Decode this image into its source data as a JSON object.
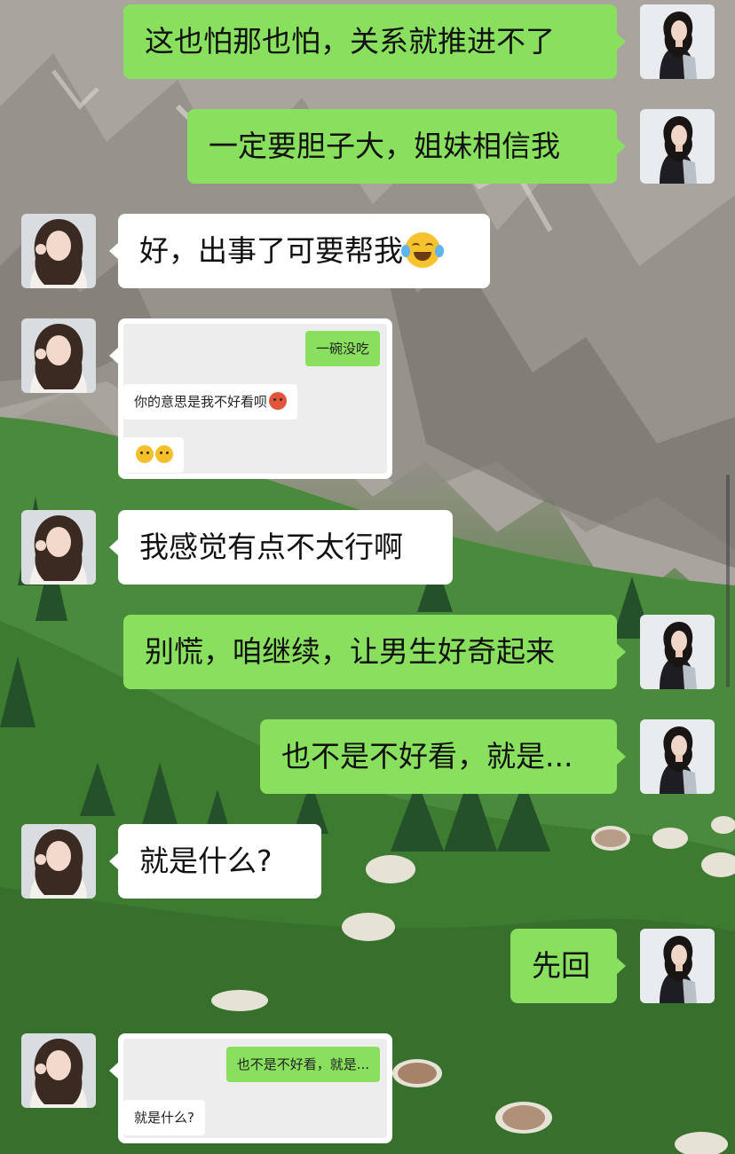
{
  "colors": {
    "bubble_self": "#89e05e",
    "bubble_other": "#ffffff",
    "quote_card_bg": "#ededed"
  },
  "messages": [
    {
      "side": "right",
      "text": "这也怕那也怕，关系就推进不了"
    },
    {
      "side": "right",
      "text": "一定要胆子大，姐妹相信我"
    },
    {
      "side": "left",
      "text": "好，出事了可要帮我",
      "emoji": "tears-of-joy-emoji"
    },
    {
      "side": "left",
      "type": "screenshot",
      "items": [
        {
          "side": "right",
          "text": "一碗没吃"
        },
        {
          "side": "left",
          "text": "你的意思是我不好看呗",
          "emoji": "angry-face-emoji"
        },
        {
          "side": "left",
          "text": "",
          "emoji": "frowning-faces-emoji"
        }
      ]
    },
    {
      "side": "left",
      "text": "我感觉有点不太行啊"
    },
    {
      "side": "right",
      "text": "别慌，咱继续，让男生好奇起来"
    },
    {
      "side": "right",
      "text": "也不是不好看，就是..."
    },
    {
      "side": "left",
      "text": "就是什么?"
    },
    {
      "side": "right",
      "text": "先回"
    },
    {
      "side": "left",
      "type": "screenshot",
      "items": [
        {
          "side": "right",
          "text": "也不是不好看，就是..."
        },
        {
          "side": "left",
          "text": "就是什么?"
        }
      ]
    }
  ]
}
